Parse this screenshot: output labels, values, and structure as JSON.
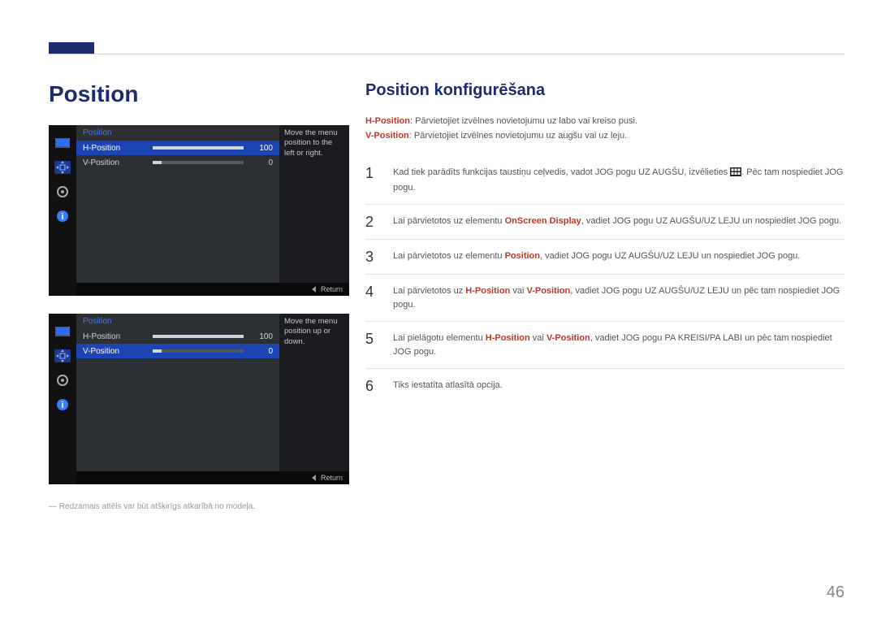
{
  "page_number": "46",
  "left": {
    "heading": "Position",
    "osd1": {
      "title": "Position",
      "rows": [
        {
          "label": "H-Position",
          "value": "100",
          "selected": true,
          "barFull": true
        },
        {
          "label": "V-Position",
          "value": "0",
          "selected": false,
          "barFull": false
        }
      ],
      "help": "Move the menu position to the left or right.",
      "return": "Return"
    },
    "osd2": {
      "title": "Position",
      "rows": [
        {
          "label": "H-Position",
          "value": "100",
          "selected": false,
          "barFull": true
        },
        {
          "label": "V-Position",
          "value": "0",
          "selected": true,
          "barFull": false
        }
      ],
      "help": "Move the menu position up or down.",
      "return": "Return"
    },
    "footnote": "Redzamais attēls var būt atšķirīgs atkarībā no modeļa."
  },
  "right": {
    "heading": "Position konfigurēšana",
    "desc": {
      "h_label": "H-Position",
      "h_text": ": Pārvietojiet izvēlnes novietojumu uz labo vai kreiso pusi.",
      "v_label": "V-Position",
      "v_text": ": Pārvietojiet izvēlnes novietojumu uz augšu vai uz leju."
    },
    "steps": [
      {
        "n": "1",
        "pre": "Kad tiek parādīts funkcijas taustiņu ceļvedis, vadot JOG pogu UZ AUGŠU, izvēlieties ",
        "post": ". Pēc tam nospiediet JOG pogu.",
        "icon": true
      },
      {
        "n": "2",
        "pre": "Lai pārvietotos uz elementu ",
        "hl": "OnScreen Display",
        "post": ", vadiet JOG pogu UZ AUGŠU/UZ LEJU un nospiediet JOG pogu."
      },
      {
        "n": "3",
        "pre": "Lai pārvietotos uz elementu ",
        "hl": "Position",
        "post": ", vadiet JOG pogu UZ AUGŠU/UZ LEJU un nospiediet JOG pogu."
      },
      {
        "n": "4",
        "pre": "Lai pārvietotos uz ",
        "hl": "H-Position",
        "mid": " vai ",
        "hl2": "V-Position",
        "post": ", vadiet JOG pogu UZ AUGŠU/UZ LEJU un pēc tam nospiediet JOG pogu."
      },
      {
        "n": "5",
        "pre": "Lai pielāgotu elementu ",
        "hl": "H-Position",
        "mid": " vai ",
        "hl2": "V-Position",
        "post": ", vadiet JOG pogu PA KREISI/PA LABI un pēc tam nospiediet JOG pogu."
      },
      {
        "n": "6",
        "pre": "Tiks iestatīta atlasītā opcija."
      }
    ]
  }
}
